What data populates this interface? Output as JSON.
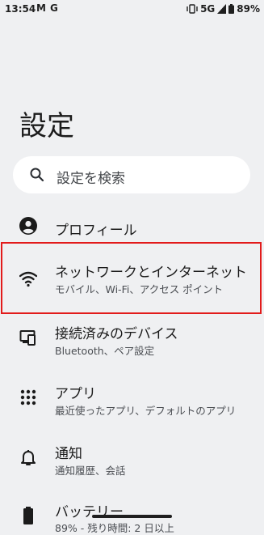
{
  "status_bar": {
    "time": "13:54",
    "notif_1": "M",
    "notif_2": "G",
    "network": "5G",
    "battery": "89%"
  },
  "page_title": "設定",
  "search": {
    "placeholder": "設定を検索"
  },
  "items": [
    {
      "label": "プロフィール",
      "sub": "",
      "icon": "account-circle-icon"
    },
    {
      "label": "ネットワークとインターネット",
      "sub": "モバイル、Wi-Fi、アクセス ポイント",
      "icon": "wifi-icon"
    },
    {
      "label": "接続済みのデバイス",
      "sub": "Bluetooth、ペア設定",
      "icon": "devices-icon"
    },
    {
      "label": "アプリ",
      "sub": "最近使ったアプリ、デフォルトのアプリ",
      "icon": "apps-grid-icon"
    },
    {
      "label": "通知",
      "sub": "通知履歴、会話",
      "icon": "bell-icon"
    },
    {
      "label": "バッテリー",
      "sub": "89% - 残り時間: 2 日以上",
      "icon": "battery-icon"
    }
  ],
  "colors": {
    "highlight": "#e21b1b",
    "background": "#eff0f2"
  }
}
